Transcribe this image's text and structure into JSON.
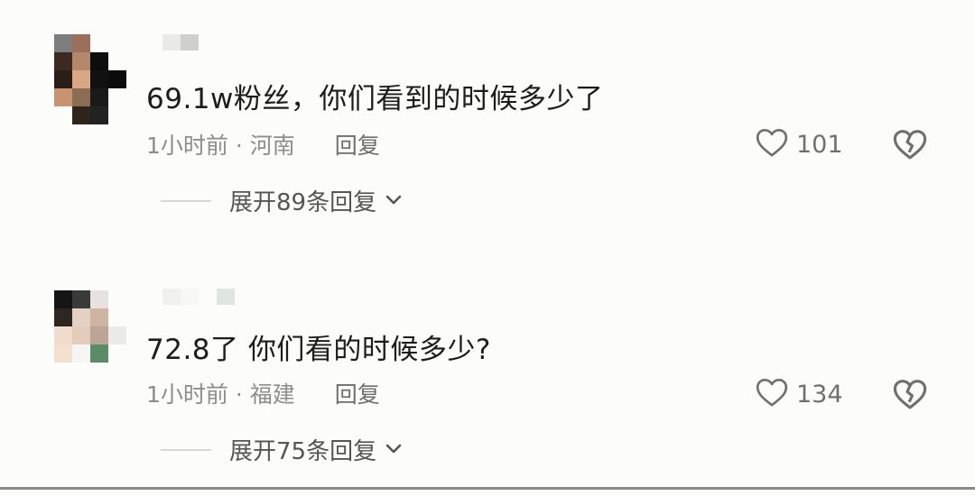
{
  "comments": [
    {
      "text": "69.1w粉丝，你们看到的时候多少了",
      "time": "1小时前",
      "sep": " · ",
      "location": "河南",
      "reply_label": "回复",
      "likes": "101",
      "expand_label": "展开89条回复",
      "icons": {
        "like": "heart-outline-icon",
        "dislike": "broken-heart-icon",
        "expand": "chevron-down-icon"
      }
    },
    {
      "text": "72.8了  你们看的时候多少?",
      "time": "1小时前",
      "sep": " · ",
      "location": "福建",
      "reply_label": "回复",
      "likes": "134",
      "expand_label": "展开75条回复",
      "icons": {
        "like": "heart-outline-icon",
        "dislike": "broken-heart-icon",
        "expand": "chevron-down-icon"
      }
    }
  ],
  "colors": {
    "background": "#fcfcfa",
    "text": "#1c1c1c",
    "meta": "#8d8d8d",
    "icon": "#6f6f6f"
  }
}
